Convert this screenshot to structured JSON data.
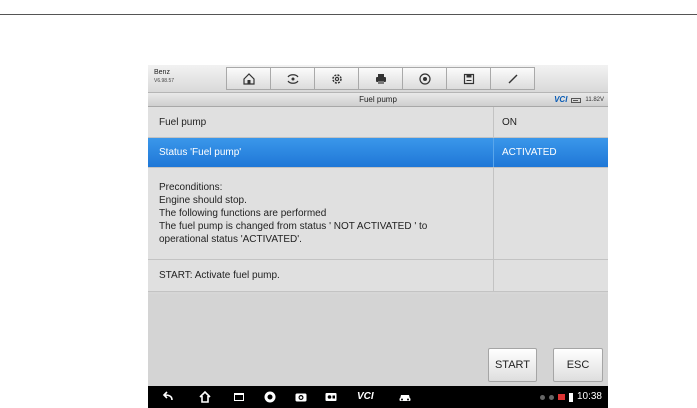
{
  "toolbar": {
    "brand": "Benz",
    "version": "V6.98.57",
    "buttons": [
      "home-icon",
      "vehicle-swap-icon",
      "settings-icon",
      "print-icon",
      "help-icon",
      "save-icon",
      "edit-icon"
    ]
  },
  "header": {
    "title": "Fuel pump",
    "vci_logo": "VCI",
    "voltage": "11.82V"
  },
  "table": {
    "rows": [
      {
        "name": "Fuel pump",
        "value": "ON"
      },
      {
        "name": "Status 'Fuel pump'",
        "value": "ACTIVATED",
        "selected": true
      },
      {
        "name_lines": [
          "Preconditions:",
          "Engine should stop.",
          "The following functions are performed",
          "The fuel pump is changed from status ' NOT ACTIVATED ' to",
          "operational status 'ACTIVATED'."
        ],
        "value": ""
      },
      {
        "name": "START: Activate fuel pump.",
        "value": ""
      }
    ]
  },
  "actions": {
    "start_label": "START",
    "esc_label": "ESC"
  },
  "navbar": {
    "icons": [
      "back-icon",
      "home-icon",
      "recent-apps-icon",
      "chrome-icon",
      "camera-icon",
      "screen-record-icon",
      "car-icon"
    ],
    "vci_label": "VCI",
    "clock": "10:38"
  }
}
